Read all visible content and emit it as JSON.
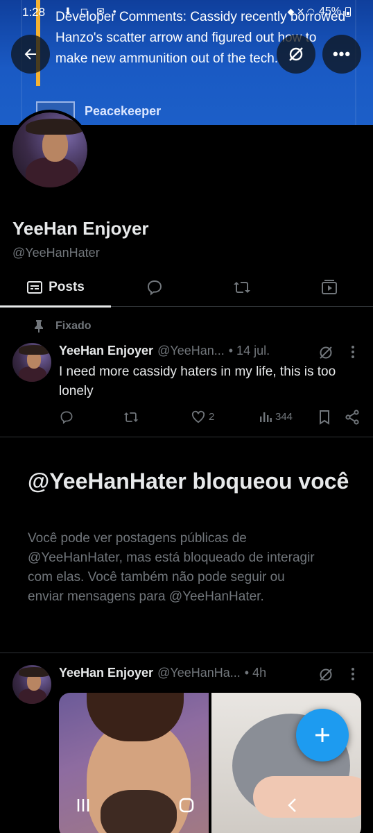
{
  "status_bar": {
    "time": "1:28",
    "battery": "45%"
  },
  "banner": {
    "text": "Developer Comments: Cassidy recently borrowed Hanzo's scatter arrow and figured out how to make new ammunition out of the tech.",
    "item_label": "Peacekeeper"
  },
  "profile": {
    "name": "YeeHan Enjoyer",
    "handle": "@YeeHanHater"
  },
  "tabs": {
    "posts_label": "Posts"
  },
  "pinned_tweet": {
    "pinned_label": "Fixado",
    "author": "YeeHan Enjoyer",
    "handle": "@YeeHan...",
    "time": "• 14 jul.",
    "text": "I need more cassidy haters in my life, this is too lonely",
    "likes": "2",
    "views": "344"
  },
  "blocked": {
    "title": "@YeeHanHater bloqueou você",
    "body": "Você pode ver postagens públicas de @YeeHanHater, mas está bloqueado de interagir com elas. Você também não pode seguir ou enviar mensagens para @YeeHanHater."
  },
  "second_tweet": {
    "author": "YeeHan Enjoyer",
    "handle": "@YeeHanHa...",
    "time": "• 4h"
  },
  "colors": {
    "accent": "#1d9bf0",
    "banner": "#1450b8",
    "muted": "#71767b",
    "text": "#e7e9ea"
  },
  "icons": [
    "back-arrow-icon",
    "grok-icon",
    "more-icon",
    "posts-icon",
    "replies-icon",
    "reposts-icon",
    "media-icon",
    "pin-icon",
    "reply-icon",
    "repost-icon",
    "like-icon",
    "views-icon",
    "bookmark-icon",
    "share-icon",
    "compose-icon"
  ]
}
